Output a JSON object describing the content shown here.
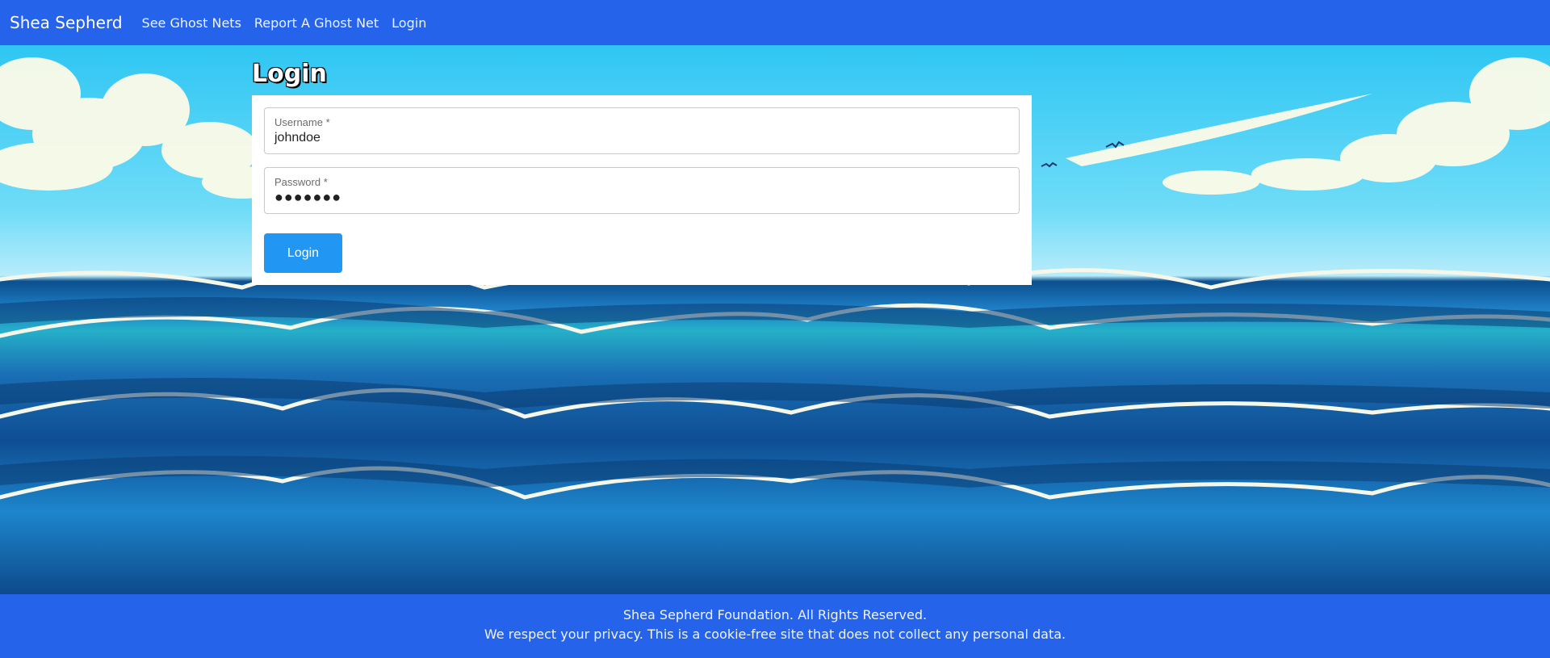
{
  "navbar": {
    "brand": "Shea Sepherd",
    "links": [
      "See Ghost Nets",
      "Report A Ghost Net",
      "Login"
    ]
  },
  "page": {
    "title": "Login"
  },
  "form": {
    "username": {
      "label": "Username *",
      "value": "johndoe"
    },
    "password": {
      "label": "Password *",
      "value": "●●●●●●●"
    },
    "submit_label": "Login"
  },
  "footer": {
    "line1": "Shea Sepherd Foundation. All Rights Reserved.",
    "line2": "We respect your privacy. This is a cookie-free site that does not collect any personal data."
  },
  "colors": {
    "nav_bg": "#2563eb",
    "button_bg": "#2196f3",
    "card_bg": "#ffffff"
  }
}
